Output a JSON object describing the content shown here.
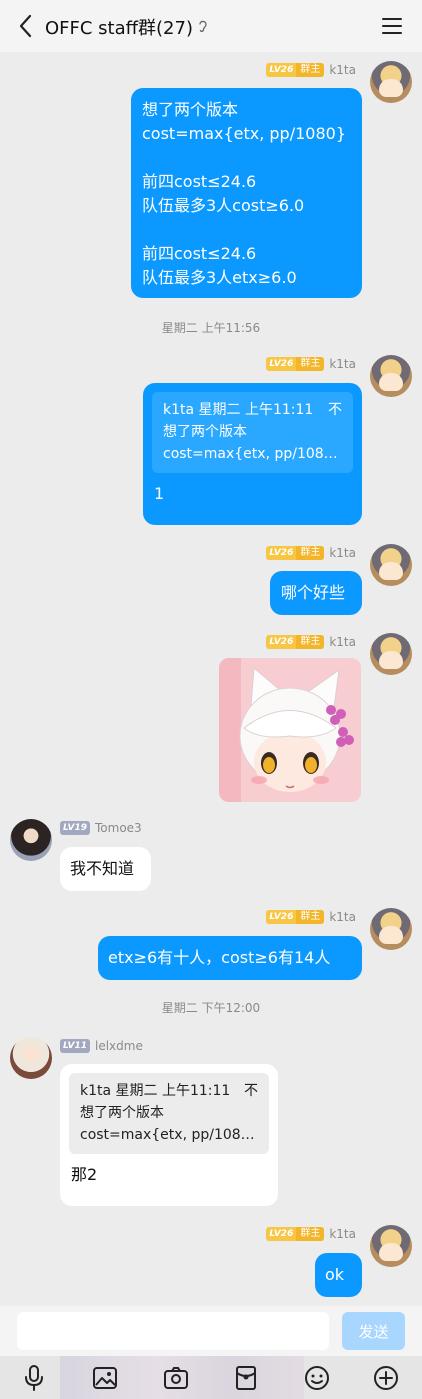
{
  "header": {
    "title": "OFFC staff群(27)",
    "back_icon": "chevron-left-icon",
    "menu_icon": "hamburger-menu-icon"
  },
  "badges": {
    "owner_level": "LV26",
    "owner_role": "群主",
    "tomoe_level": "LV19",
    "lelx_level": "LV11"
  },
  "users": {
    "k1ta": "k1ta",
    "tomoe": "Tomoe3",
    "lelx": "lelxdme"
  },
  "messages": {
    "m1": {
      "lines": [
        "想了两个版本",
        "cost=max{etx, pp/1080}",
        "",
        "前四cost≤24.6",
        "队伍最多3人cost≥6.0",
        "",
        "前四cost≤24.6",
        "队伍最多3人etx≥6.0"
      ]
    },
    "time1": "星期二 上午11:56",
    "m2": {
      "quote_header": "k1ta 星期二 上午11:11",
      "quote_icon_glyph": "不",
      "quote_line1": "想了两个版本",
      "quote_line2": "cost=max{etx, pp/108…",
      "text": "1"
    },
    "m3": {
      "text": "哪个好些"
    },
    "m4": {
      "sticker": "anime-cat-girl-sticker"
    },
    "m5": {
      "text": "我不知道"
    },
    "m6": {
      "text": "etx≥6有十人，cost≥6有14人"
    },
    "time2": "星期二 下午12:00",
    "m7": {
      "quote_header": "k1ta 星期二 上午11:11",
      "quote_icon_glyph": "不",
      "quote_line1": "想了两个版本",
      "quote_line2": "cost=max{etx, pp/108…",
      "text": "那2"
    },
    "m8": {
      "text": "ok"
    }
  },
  "composer": {
    "send_label": "发送",
    "input_value": ""
  },
  "toolbar": [
    "microphone-icon",
    "image-icon",
    "camera-icon",
    "red-packet-icon",
    "emoji-icon",
    "plus-icon"
  ],
  "colors": {
    "bubble_out": "#0b99ff",
    "bubble_in": "#ffffff",
    "background": "#ececec",
    "send_disabled": "#a9d6ff",
    "owner_badge": "#f6c644"
  }
}
